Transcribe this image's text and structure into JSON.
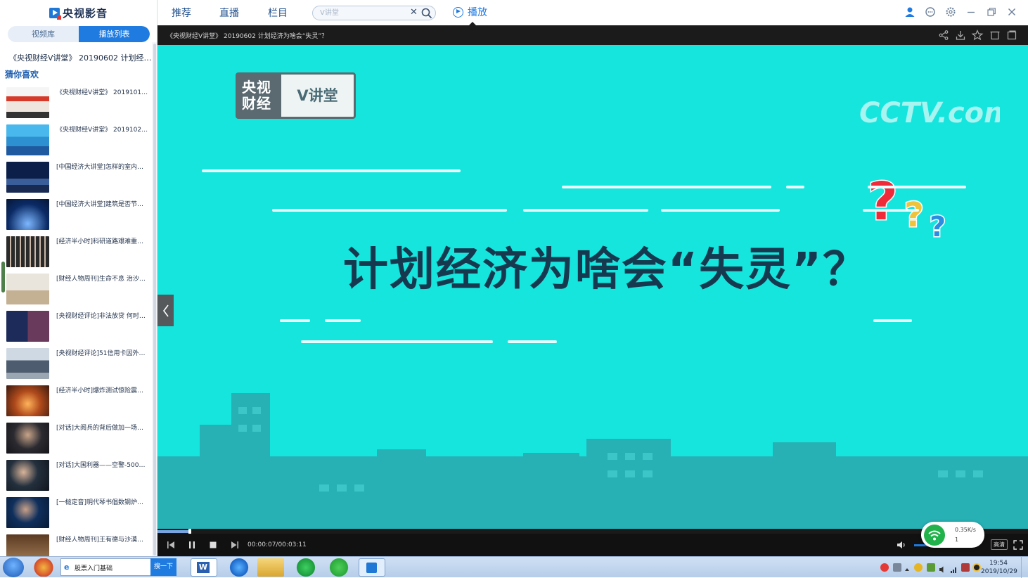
{
  "app": {
    "name": "央视影音"
  },
  "sidebar": {
    "tabs": [
      {
        "label": "视频库",
        "active": false
      },
      {
        "label": "播放列表",
        "active": true
      }
    ],
    "current_item": "《央视财经V讲堂》 20190602 计划经济为啥会“失灵”？",
    "section_title": "猜你喜欢",
    "items": [
      {
        "title": "《央视财经V讲堂》 20191010 …"
      },
      {
        "title": "《央视财经V讲堂》 20191025 …"
      },
      {
        "title": "[中国经济大讲堂]怎样的室内…"
      },
      {
        "title": "[中国经济大讲堂]建筑是否节…"
      },
      {
        "title": "[经济半小时]科研道路艰难重…"
      },
      {
        "title": "[财经人物周刊]生命不息 治沙…"
      },
      {
        "title": "[央视财经评论]非法放贷 何时…"
      },
      {
        "title": "[央视财经评论]51信用卡因外…"
      },
      {
        "title": "[经济半小时]爆炸测试惊险震…"
      },
      {
        "title": "[对话]大阅兵的背后做加一场…"
      },
      {
        "title": "[对话]大国利器——空警-500…"
      },
      {
        "title": "[一槌定音]明代琴书倡数钢炉…"
      },
      {
        "title": "[财经人物周刊]王有德与沙漠…"
      }
    ]
  },
  "topnav": {
    "items": [
      "推荐",
      "直播",
      "栏目"
    ],
    "search": {
      "placeholder": "V讲堂",
      "value": ""
    },
    "play_tab": "播放"
  },
  "player": {
    "video_title": "《央视财经V讲堂》 20190602 计划经济为啥会“失灵”？",
    "frame": {
      "logo_left": "央视财经",
      "logo_right": "V讲堂",
      "watermark": "CCTV.com",
      "headline": "计划经济为啥会“失灵”？"
    },
    "time": "00:00:07/00:03:11",
    "progress_fraction": 0.037,
    "volume_fraction": 0.3,
    "quality": "高清"
  },
  "network": {
    "up": "0.35K/s",
    "down": "1"
  },
  "taskbar": {
    "search": {
      "value": "股票入门基础",
      "button": "搜一下"
    },
    "time": "19:54",
    "date": "2019/10/29"
  },
  "colors": {
    "accent": "#1f7be0",
    "video_bg": "#16e5de",
    "headline": "#16394f"
  }
}
